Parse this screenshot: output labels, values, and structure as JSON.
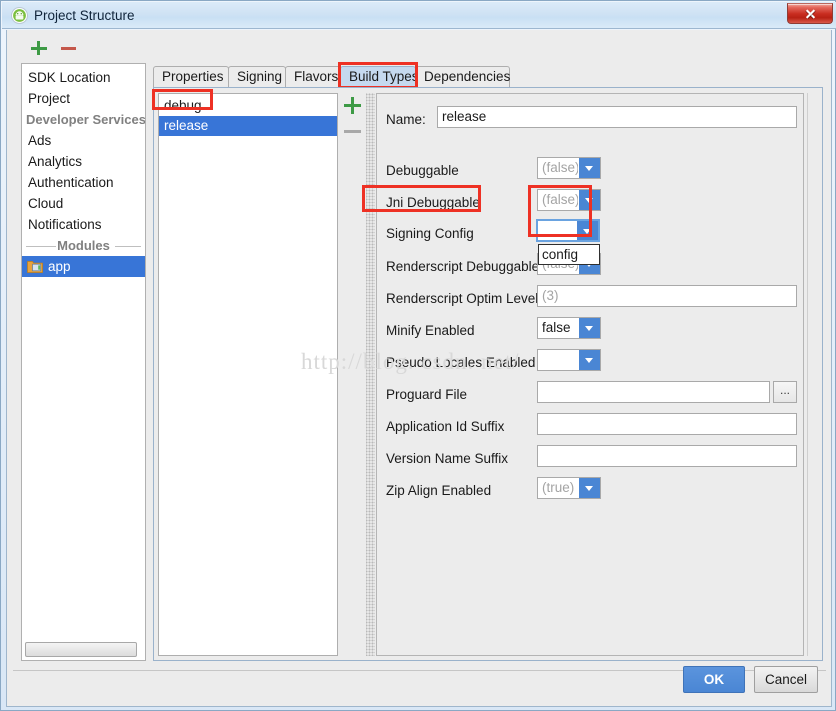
{
  "window": {
    "title": "Project Structure",
    "icon": "android-robot-icon",
    "close_label": "x"
  },
  "sidebar": {
    "toolbar": {
      "add_label": "+",
      "remove_label": "−"
    },
    "items": [
      {
        "label": "SDK Location",
        "type": "item",
        "selected": false
      },
      {
        "label": "Project",
        "type": "item",
        "selected": false
      },
      {
        "label": "Developer Services",
        "type": "group-left",
        "selected": false
      },
      {
        "label": "Ads",
        "type": "item",
        "selected": false
      },
      {
        "label": "Analytics",
        "type": "item",
        "selected": false
      },
      {
        "label": "Authentication",
        "type": "item",
        "selected": false
      },
      {
        "label": "Cloud",
        "type": "item",
        "selected": false
      },
      {
        "label": "Notifications",
        "type": "item",
        "selected": false
      },
      {
        "label": "Modules",
        "type": "group",
        "selected": false
      },
      {
        "label": "app",
        "type": "module",
        "selected": true,
        "icon": "module-folder-icon"
      }
    ]
  },
  "tabs": [
    {
      "label": "Properties",
      "selected": false
    },
    {
      "label": "Signing",
      "selected": false
    },
    {
      "label": "Flavors",
      "selected": false
    },
    {
      "label": "Build Types",
      "selected": true,
      "highlighted": true
    },
    {
      "label": "Dependencies",
      "selected": false
    }
  ],
  "build_types": {
    "toolbar": {
      "add_label": "+",
      "remove_label": "−"
    },
    "items": [
      {
        "label": "debug",
        "selected": false,
        "highlighted": false
      },
      {
        "label": "release",
        "selected": true,
        "highlighted": true
      }
    ]
  },
  "form": {
    "name": {
      "label": "Name:",
      "value": "release",
      "placeholder": ""
    },
    "fields": [
      {
        "label": "Debuggable",
        "kind": "combo",
        "value": "(false)",
        "dim": true
      },
      {
        "label": "Jni Debuggable",
        "kind": "combo",
        "value": "(false)",
        "dim": true
      },
      {
        "label": "Signing Config",
        "kind": "combo",
        "value": "",
        "dim": false,
        "focused": true,
        "highlighted": true,
        "popup_open": true,
        "popup_option": "config"
      },
      {
        "label": "Renderscript Debuggable",
        "kind": "combo",
        "value": "(false)",
        "dim": true
      },
      {
        "label": "Renderscript Optim Level",
        "kind": "text",
        "value": "(3)",
        "dim": true
      },
      {
        "label": "Minify Enabled",
        "kind": "combo",
        "value": "false",
        "dim": false
      },
      {
        "label": "Pseudo Locales Enabled",
        "kind": "combo",
        "value": "",
        "dim": false
      },
      {
        "label": "Proguard File",
        "kind": "text-browse",
        "value": "",
        "dim": false,
        "browse_label": "..."
      },
      {
        "label": "Application Id Suffix",
        "kind": "text-wide",
        "value": "",
        "dim": false
      },
      {
        "label": "Version Name Suffix",
        "kind": "text-wide",
        "value": "",
        "dim": false
      },
      {
        "label": "Zip Align Enabled",
        "kind": "combo",
        "value": "(true)",
        "dim": true
      }
    ]
  },
  "footer": {
    "ok_label": "OK",
    "cancel_label": "Cancel"
  },
  "watermark": {
    "text": "http://blog. csdn. net/"
  },
  "colors": {
    "accent_blue": "#4a86d4",
    "selection_blue": "#3875d7",
    "highlight_red": "#ee3124",
    "tab_selected": "#c5d9ef",
    "panel_bg": "#ececec"
  }
}
